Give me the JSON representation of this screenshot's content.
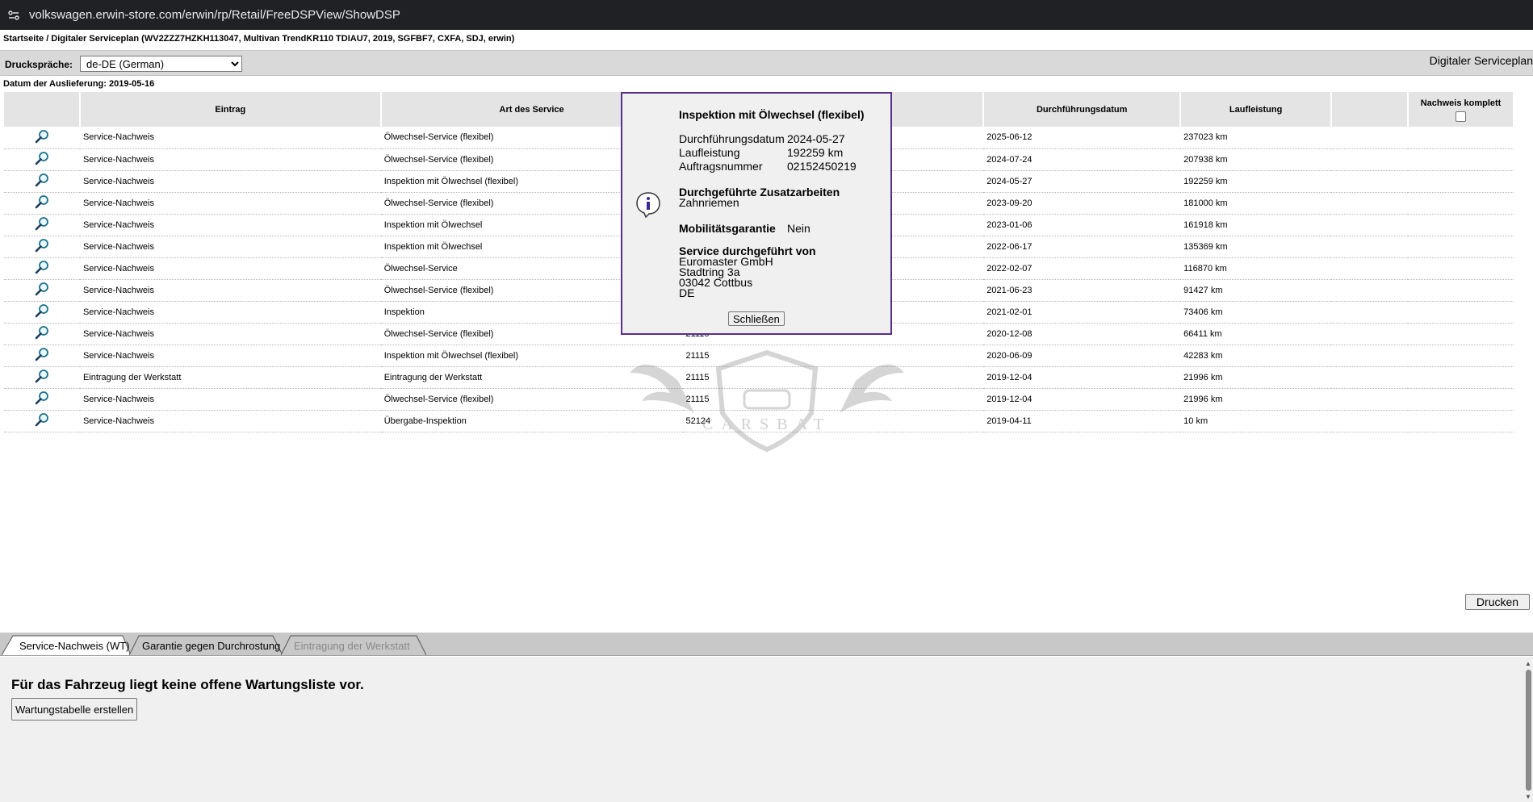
{
  "browser": {
    "url": "volkswagen.erwin-store.com/erwin/rp/Retail/FreeDSPView/ShowDSP"
  },
  "breadcrumb": "Startseite / Digitaler Serviceplan (WV2ZZZ7HZKH113047, Multivan TrendKR110 TDIAU7, 2019, SGFBF7, CXFA, SDJ, erwin)",
  "toolbar": {
    "lang_label": "Druckspräche:",
    "lang_value": "de-DE (German)",
    "right_title": "Digitaler Serviceplan"
  },
  "delivery_date": "Datum der Auslieferung: 2019-05-16",
  "table": {
    "headers": [
      "Eintrag",
      "Art des Service",
      "",
      "",
      "Durchführungsdatum",
      "Laufleistung",
      "",
      "Nachweis komplett"
    ],
    "rows": [
      {
        "eintrag": "Service-Nachweis",
        "art": "Ölwechsel-Service (flexibel)",
        "code": "",
        "date": "2025-06-12",
        "km": "237023 km"
      },
      {
        "eintrag": "Service-Nachweis",
        "art": "Ölwechsel-Service (flexibel)",
        "code": "",
        "date": "2024-07-24",
        "km": "207938 km"
      },
      {
        "eintrag": "Service-Nachweis",
        "art": "Inspektion mit Ölwechsel (flexibel)",
        "code": "",
        "date": "2024-05-27",
        "km": "192259 km"
      },
      {
        "eintrag": "Service-Nachweis",
        "art": "Ölwechsel-Service (flexibel)",
        "code": "",
        "date": "2023-09-20",
        "km": "181000 km"
      },
      {
        "eintrag": "Service-Nachweis",
        "art": "Inspektion mit Ölwechsel",
        "code": "",
        "date": "2023-01-06",
        "km": "161918 km"
      },
      {
        "eintrag": "Service-Nachweis",
        "art": "Inspektion mit Ölwechsel",
        "code": "",
        "date": "2022-06-17",
        "km": "135369 km"
      },
      {
        "eintrag": "Service-Nachweis",
        "art": "Ölwechsel-Service",
        "code": "",
        "date": "2022-02-07",
        "km": "116870 km"
      },
      {
        "eintrag": "Service-Nachweis",
        "art": "Ölwechsel-Service (flexibel)",
        "code": "",
        "date": "2021-06-23",
        "km": "91427 km"
      },
      {
        "eintrag": "Service-Nachweis",
        "art": "Inspektion",
        "code": "",
        "date": "2021-02-01",
        "km": "73406 km"
      },
      {
        "eintrag": "Service-Nachweis",
        "art": "Ölwechsel-Service (flexibel)",
        "code": "21115",
        "date": "2020-12-08",
        "km": "66411 km"
      },
      {
        "eintrag": "Service-Nachweis",
        "art": "Inspektion mit Ölwechsel (flexibel)",
        "code": "21115",
        "date": "2020-06-09",
        "km": "42283 km"
      },
      {
        "eintrag": "Eintragung der Werkstatt",
        "art": "Eintragung der Werkstatt",
        "code": "21115",
        "date": "2019-12-04",
        "km": "21996 km"
      },
      {
        "eintrag": "Service-Nachweis",
        "art": "Ölwechsel-Service (flexibel)",
        "code": "21115",
        "date": "2019-12-04",
        "km": "21996 km"
      },
      {
        "eintrag": "Service-Nachweis",
        "art": "Übergabe-Inspektion",
        "code": "52124",
        "date": "2019-04-11",
        "km": "10 km"
      }
    ]
  },
  "watermark": {
    "text": "CARSBAT"
  },
  "popup": {
    "title": "Inspektion mit Ölwechsel (flexibel)",
    "fields": [
      {
        "label": "Durchführungsdatum",
        "value": "2024-05-27"
      },
      {
        "label": "Laufleistung",
        "value": "192259 km"
      },
      {
        "label": "Auftragsnummer",
        "value": "02152450219"
      }
    ],
    "extra_heading": "Durchgeführte Zusatzarbeiten",
    "extra_value": "Zahnriemen",
    "mobility_label": "Mobilitätsgarantie",
    "mobility_value": "Nein",
    "performed_heading": "Service durchgeführt von",
    "performed_by": [
      "Euromaster GmbH",
      "Stadtring 3a",
      "03042 Cottbus",
      "DE"
    ],
    "close_label": "Schließen"
  },
  "print_label": "Drucken",
  "tabs": [
    {
      "label": "Service-Nachweis (WT)"
    },
    {
      "label": "Garantie gegen Durchrostung"
    },
    {
      "label": "Eintragung der Werkstatt"
    }
  ],
  "bottom": {
    "message": "Für das Fahrzeug liegt keine offene Wartungsliste vor.",
    "create_label": "Wartungstabelle erstellen"
  },
  "colors": {
    "popup_border": "#5b2d8c",
    "header_bg": "#e4e4e4",
    "toolbar_bg": "#d9d9d9"
  }
}
